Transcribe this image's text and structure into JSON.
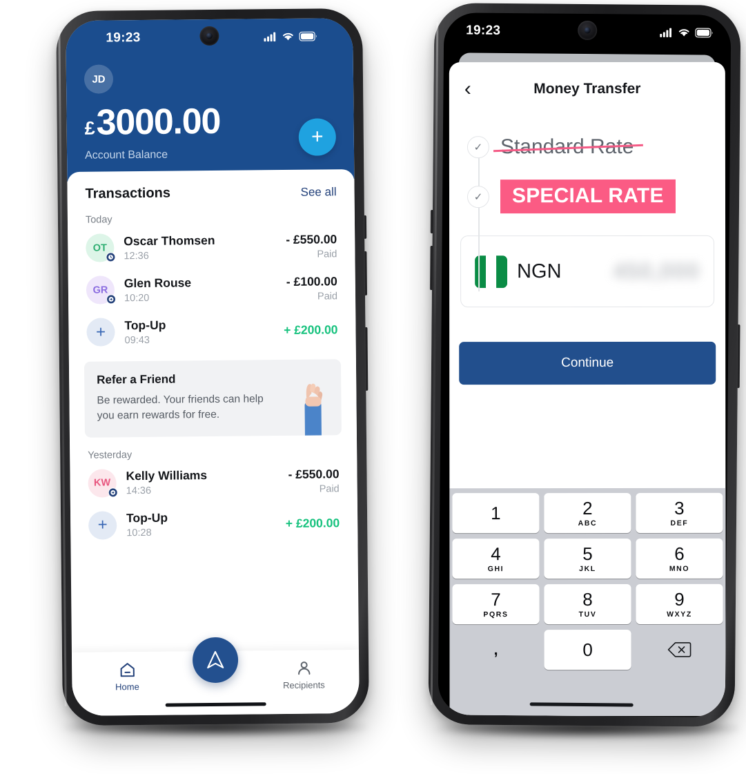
{
  "phone_left": {
    "status_bar": {
      "time": "19:23",
      "signal_icon": "cellular-signal-icon",
      "wifi_icon": "wifi-icon",
      "battery_icon": "battery-icon"
    },
    "header": {
      "avatar_initials": "JD",
      "currency_symbol": "£",
      "balance": "3000.00",
      "balance_label": "Account Balance",
      "add_button_label": "+"
    },
    "transactions": {
      "title": "Transactions",
      "see_all_label": "See all",
      "groups": [
        {
          "day_label": "Today",
          "items": [
            {
              "initials": "OT",
              "name": "Oscar Thomsen",
              "time": "12:36",
              "amount": "- £550.00",
              "status": "Paid",
              "positive": false,
              "avatar_bg": "#ddf5e8",
              "avatar_fg": "#2fae72",
              "badge": "clock-badge-icon"
            },
            {
              "initials": "GR",
              "name": "Glen Rouse",
              "time": "10:20",
              "amount": "- £100.00",
              "status": "Paid",
              "positive": false,
              "avatar_bg": "#efe6fb",
              "avatar_fg": "#8b6ce0",
              "badge": "arrow-badge-icon"
            },
            {
              "initials": "+",
              "name": "Top-Up",
              "time": "09:43",
              "amount": "+ £200.00",
              "status": "",
              "positive": true,
              "avatar_bg": "#e3eaf5",
              "avatar_fg": "#3766b4",
              "badge": ""
            }
          ]
        },
        {
          "day_label": "Yesterday",
          "items": [
            {
              "initials": "KW",
              "name": "Kelly Williams",
              "time": "14:36",
              "amount": "- £550.00",
              "status": "Paid",
              "positive": false,
              "avatar_bg": "#fce7ec",
              "avatar_fg": "#e8567f",
              "badge": "arrow-badge-icon"
            },
            {
              "initials": "+",
              "name": "Top-Up",
              "time": "10:28",
              "amount": "+ £200.00",
              "status": "",
              "positive": true,
              "avatar_bg": "#e3eaf5",
              "avatar_fg": "#3766b4",
              "badge": ""
            }
          ]
        }
      ]
    },
    "refer_card": {
      "title": "Refer a Friend",
      "body": "Be rewarded. Your friends can help you earn rewards for free.",
      "illustration": "raised-hand-illustration"
    },
    "bottom_nav": {
      "home_label": "Home",
      "home_icon": "home-icon",
      "recipients_label": "Recipients",
      "recipients_icon": "person-icon",
      "send_icon": "send-arrow-icon"
    }
  },
  "phone_right": {
    "status_bar": {
      "time": "19:23",
      "signal_icon": "cellular-signal-icon",
      "wifi_icon": "wifi-icon",
      "battery_icon": "battery-icon"
    },
    "sheet": {
      "back_icon": "chevron-left-icon",
      "title": "Money Transfer",
      "rates": {
        "standard_label": "Standard Rate",
        "special_label": "SPECIAL RATE",
        "check_icon": "check-icon"
      },
      "amount_card": {
        "flag": "nigeria-flag-icon",
        "currency_code": "NGN",
        "amount_masked": "450,000"
      },
      "continue_label": "Continue"
    },
    "keypad": {
      "keys": [
        {
          "num": "1",
          "sub": ""
        },
        {
          "num": "2",
          "sub": "ABC"
        },
        {
          "num": "3",
          "sub": "DEF"
        },
        {
          "num": "4",
          "sub": "GHI"
        },
        {
          "num": "5",
          "sub": "JKL"
        },
        {
          "num": "6",
          "sub": "MNO"
        },
        {
          "num": "7",
          "sub": "PQRS"
        },
        {
          "num": "8",
          "sub": "TUV"
        },
        {
          "num": "9",
          "sub": "WXYZ"
        },
        {
          "num": "0",
          "sub": ""
        }
      ],
      "comma_label": ",",
      "backspace_icon": "backspace-icon"
    }
  },
  "colors": {
    "brand_navy": "#1b4d8e",
    "accent_cyan": "#1fa2e0",
    "accent_pink": "#fb5b84",
    "positive_green": "#17c27e"
  }
}
